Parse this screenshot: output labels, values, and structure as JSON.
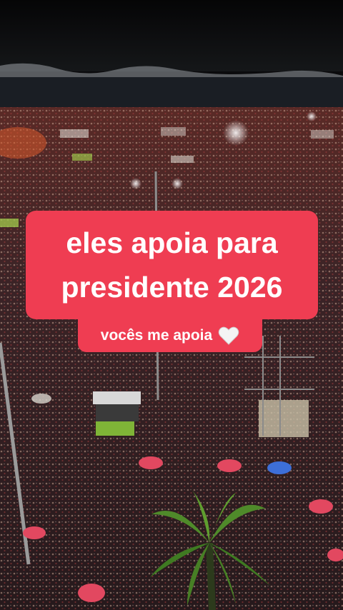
{
  "caption": {
    "line1": "eles apoia para",
    "line2": "presidente 2026",
    "sub": "vocês me apoia"
  },
  "scene": {
    "description_icon": "white-heart-icon",
    "sky_color": "#0b0b0d",
    "sea_color": "#1a1e24",
    "crowd_color": "#3a2228",
    "accent_color": "#ef3d52"
  }
}
